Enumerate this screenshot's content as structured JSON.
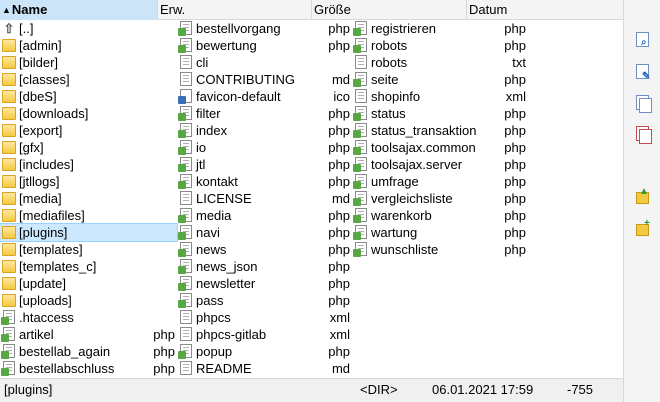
{
  "header": {
    "name": "Name",
    "ext": "Erw.",
    "size": "Größe",
    "date": "Datum"
  },
  "columns": [
    [
      {
        "name": "[..]",
        "ext": "",
        "icon": "parent-dir-icon"
      },
      {
        "name": "[admin]",
        "ext": "",
        "icon": "folder-icon"
      },
      {
        "name": "[bilder]",
        "ext": "",
        "icon": "folder-icon"
      },
      {
        "name": "[classes]",
        "ext": "",
        "icon": "folder-icon"
      },
      {
        "name": "[dbeS]",
        "ext": "",
        "icon": "folder-icon"
      },
      {
        "name": "[downloads]",
        "ext": "",
        "icon": "folder-icon"
      },
      {
        "name": "[export]",
        "ext": "",
        "icon": "folder-icon"
      },
      {
        "name": "[gfx]",
        "ext": "",
        "icon": "folder-icon"
      },
      {
        "name": "[includes]",
        "ext": "",
        "icon": "folder-icon"
      },
      {
        "name": "[jtllogs]",
        "ext": "",
        "icon": "folder-icon"
      },
      {
        "name": "[media]",
        "ext": "",
        "icon": "folder-icon"
      },
      {
        "name": "[mediafiles]",
        "ext": "",
        "icon": "folder-icon"
      },
      {
        "name": "[plugins]",
        "ext": "",
        "icon": "folder-icon",
        "selected": true
      },
      {
        "name": "[templates]",
        "ext": "",
        "icon": "folder-icon"
      },
      {
        "name": "[templates_c]",
        "ext": "",
        "icon": "folder-icon"
      },
      {
        "name": "[update]",
        "ext": "",
        "icon": "folder-icon"
      },
      {
        "name": "[uploads]",
        "ext": "",
        "icon": "folder-icon"
      },
      {
        "name": ".htaccess",
        "ext": "",
        "icon": "php-file-icon"
      },
      {
        "name": "artikel",
        "ext": "php",
        "icon": "php-file-icon"
      },
      {
        "name": "bestellab_again",
        "ext": "php",
        "icon": "php-file-icon"
      },
      {
        "name": "bestellabschluss",
        "ext": "php",
        "icon": "php-file-icon"
      }
    ],
    [
      {
        "name": "bestellvorgang",
        "ext": "php",
        "icon": "php-file-icon"
      },
      {
        "name": "bewertung",
        "ext": "php",
        "icon": "php-file-icon"
      },
      {
        "name": "cli",
        "ext": "",
        "icon": "file-icon"
      },
      {
        "name": "CONTRIBUTING",
        "ext": "md",
        "icon": "file-icon"
      },
      {
        "name": "favicon-default",
        "ext": "ico",
        "icon": "image-file-icon"
      },
      {
        "name": "filter",
        "ext": "php",
        "icon": "php-file-icon"
      },
      {
        "name": "index",
        "ext": "php",
        "icon": "php-file-icon"
      },
      {
        "name": "io",
        "ext": "php",
        "icon": "php-file-icon"
      },
      {
        "name": "jtl",
        "ext": "php",
        "icon": "php-file-icon"
      },
      {
        "name": "kontakt",
        "ext": "php",
        "icon": "php-file-icon"
      },
      {
        "name": "LICENSE",
        "ext": "md",
        "icon": "file-icon"
      },
      {
        "name": "media",
        "ext": "php",
        "icon": "php-file-icon"
      },
      {
        "name": "navi",
        "ext": "php",
        "icon": "php-file-icon"
      },
      {
        "name": "news",
        "ext": "php",
        "icon": "php-file-icon"
      },
      {
        "name": "news_json",
        "ext": "php",
        "icon": "php-file-icon"
      },
      {
        "name": "newsletter",
        "ext": "php",
        "icon": "php-file-icon"
      },
      {
        "name": "pass",
        "ext": "php",
        "icon": "php-file-icon"
      },
      {
        "name": "phpcs",
        "ext": "xml",
        "icon": "xml-file-icon"
      },
      {
        "name": "phpcs-gitlab",
        "ext": "xml",
        "icon": "xml-file-icon"
      },
      {
        "name": "popup",
        "ext": "php",
        "icon": "php-file-icon"
      },
      {
        "name": "README",
        "ext": "md",
        "icon": "file-icon"
      }
    ],
    [
      {
        "name": "registrieren",
        "ext": "php",
        "icon": "php-file-icon"
      },
      {
        "name": "robots",
        "ext": "php",
        "icon": "php-file-icon"
      },
      {
        "name": "robots",
        "ext": "txt",
        "icon": "text-file-icon"
      },
      {
        "name": "seite",
        "ext": "php",
        "icon": "php-file-icon"
      },
      {
        "name": "shopinfo",
        "ext": "xml",
        "icon": "xml-file-icon"
      },
      {
        "name": "status",
        "ext": "php",
        "icon": "php-file-icon"
      },
      {
        "name": "status_transaktion",
        "ext": "php",
        "icon": "php-file-icon"
      },
      {
        "name": "toolsajax.common",
        "ext": "php",
        "icon": "php-file-icon"
      },
      {
        "name": "toolsajax.server",
        "ext": "php",
        "icon": "php-file-icon"
      },
      {
        "name": "umfrage",
        "ext": "php",
        "icon": "php-file-icon"
      },
      {
        "name": "vergleichsliste",
        "ext": "php",
        "icon": "php-file-icon"
      },
      {
        "name": "warenkorb",
        "ext": "php",
        "icon": "php-file-icon"
      },
      {
        "name": "wartung",
        "ext": "php",
        "icon": "php-file-icon"
      },
      {
        "name": "wunschliste",
        "ext": "php",
        "icon": "php-file-icon"
      }
    ]
  ],
  "status": {
    "name": "[plugins]",
    "size": "<DIR>",
    "date": "06.01.2021 17:59",
    "attr": "-755"
  },
  "toolbar": [
    {
      "icon": "view-file-icon"
    },
    {
      "icon": "edit-file-icon"
    },
    {
      "icon": "copy-file-icon"
    },
    {
      "icon": "move-file-icon"
    },
    {
      "icon": "upload-file-icon"
    },
    {
      "icon": "new-folder-icon"
    }
  ],
  "colors": {
    "selection": "#cce8ff",
    "header_sorted": "#cce4f7",
    "folder": "#f5c842",
    "php_badge": "#56a845"
  }
}
